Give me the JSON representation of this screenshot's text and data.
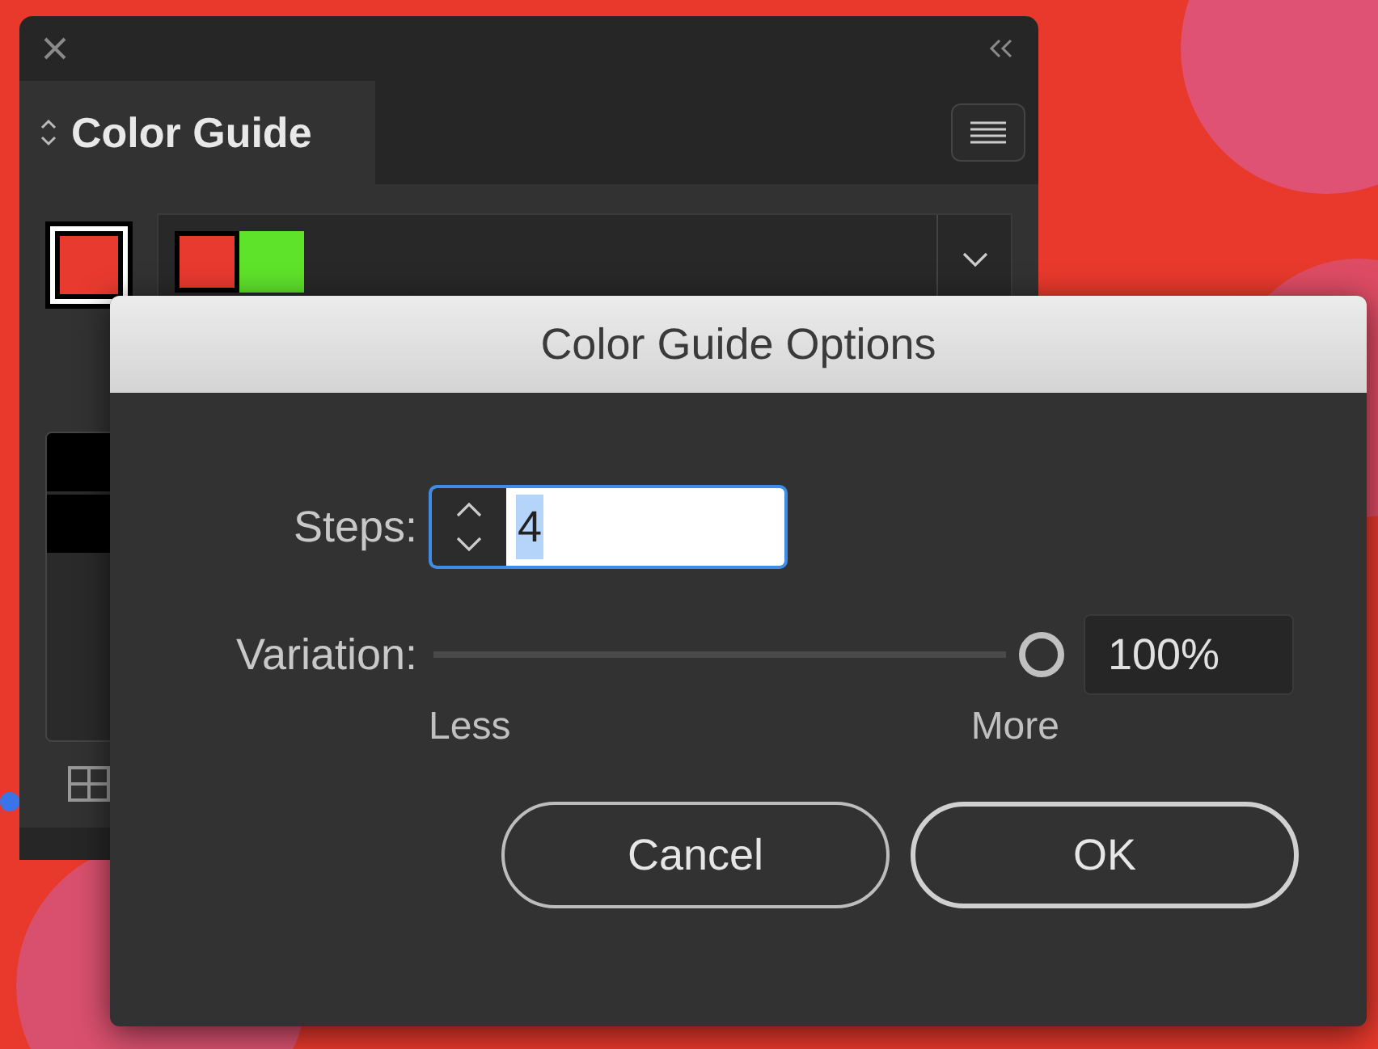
{
  "panel": {
    "title": "Color Guide",
    "base_color": {
      "color": "#e83a2e"
    },
    "harmony": [
      {
        "color": "#e83a2e"
      },
      {
        "color": "#5fe22a"
      }
    ]
  },
  "dialog": {
    "title": "Color Guide Options",
    "steps": {
      "label": "Steps:",
      "value": "4",
      "value_selected": true
    },
    "variation": {
      "label": "Variation:",
      "level": 1,
      "reading": "100%",
      "min_label": "Less",
      "max_label": "More"
    },
    "buttons": [
      {
        "label": "Cancel",
        "kind": "secondary"
      },
      {
        "label": "OK",
        "kind": "default"
      }
    ]
  }
}
